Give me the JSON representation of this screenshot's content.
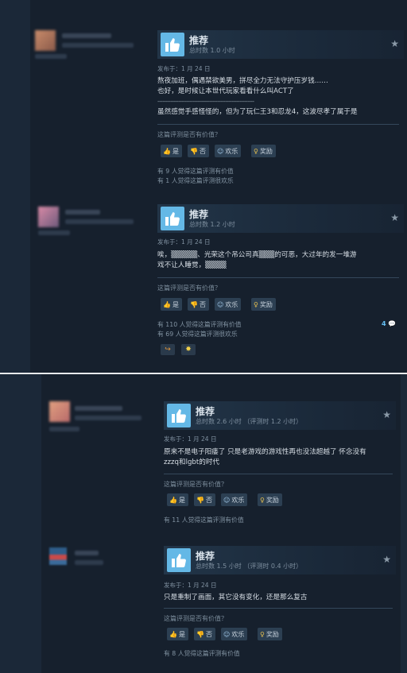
{
  "reviews": [
    {
      "verdict": "推荐",
      "hours": "总时数 1.0 小时",
      "date": "发布于：1 月 24 日",
      "lines": [
        "熬夜加班，偶遇禁欲美男，拼尽全力无法守护压岁钱……",
        "也好，是时候让本世代玩家看看什么叫ACT了",
        "------------------------------------------------------------",
        "虽然感觉手感怪怪的，但为了玩仁王3和忍龙4，这波尽孝了属于是"
      ],
      "question": "这篇评测是否有价值？",
      "yes": "是",
      "no": "否",
      "funny": "欢乐",
      "award": "奖励",
      "stat1": "有 9 人觉得这篇评测有价值",
      "stat2": "有 1 人觉得这篇评测很欢乐"
    },
    {
      "verdict": "推荐",
      "hours": "总时数 1.2 小时",
      "date": "发布于：1 月 24 日",
      "lines": [
        "唉，▒▒▒▒▒、光荣这个吊公司真▒▒▒的可恶，大过年的发一堆游",
        "戏不让人睡觉，▒▒▒▒"
      ],
      "question": "这篇评测是否有价值？",
      "yes": "是",
      "no": "否",
      "funny": "欢乐",
      "award": "奖励",
      "stat1": "有 110 人觉得这篇评测有价值",
      "stat2": "有 69 人觉得这篇评测很欢乐",
      "comments": "4"
    },
    {
      "verdict": "推荐",
      "hours": "总时数 2.6 小时  （评测时 1.2 小时）",
      "date": "发布于：1 月 24 日",
      "lines": [
        "原来不是电子阳痿了 只是老游戏的游戏性再也没法超越了 怀念没有",
        "zzzq和lgbt的时代"
      ],
      "question": "这篇评测是否有价值？",
      "yes": "是",
      "no": "否",
      "funny": "欢乐",
      "award": "奖励",
      "stat1": "有 11 人觉得这篇评测有价值"
    },
    {
      "verdict": "推荐",
      "hours": "总时数 1.5 小时  （评测时 0.4 小时）",
      "date": "发布于：1 月 24 日",
      "lines": [
        "只是重制了画面，其它没有变化，还是那么复古"
      ],
      "question": "这篇评测是否有价值？",
      "yes": "是",
      "no": "否",
      "funny": "欢乐",
      "award": "奖励",
      "stat1": "有 8 人觉得这篇评测有价值"
    }
  ],
  "colors": {
    "background": "#1b2838",
    "card": "#16202d",
    "accent": "#64b8e6",
    "link": "#66c0f4",
    "award": "#e8c14f"
  },
  "icons": [
    "thumbs-up-icon",
    "thumbs-down-icon",
    "smile-icon",
    "award-icon",
    "star-icon",
    "comment-icon"
  ]
}
